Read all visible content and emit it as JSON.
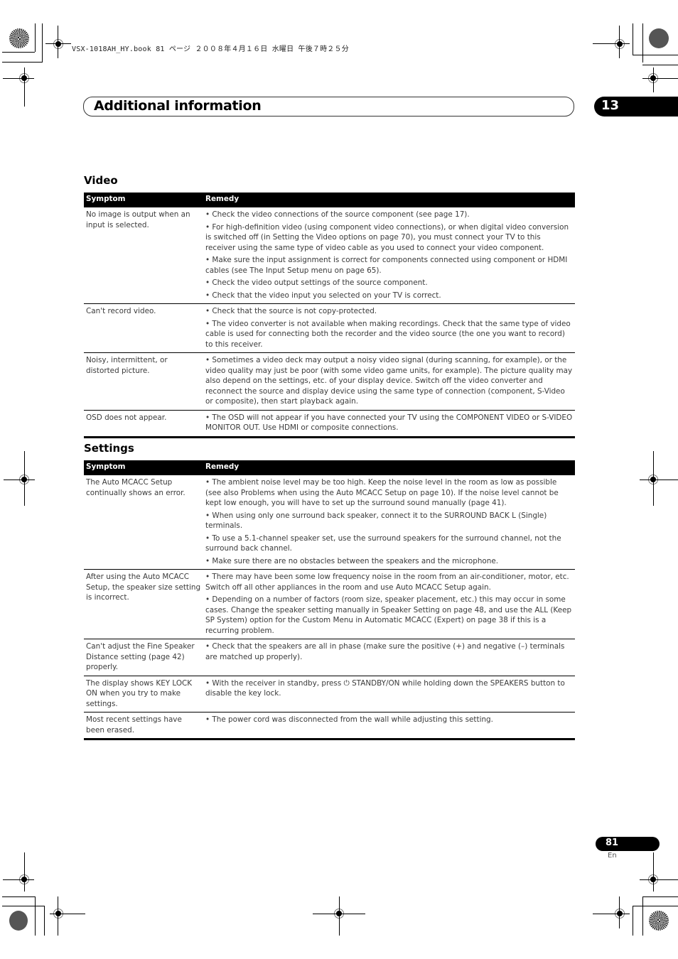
{
  "print_header": {
    "text": "VSX-1018AH_HY.book  81 ページ  ２００８年４月１６日  水曜日  午後７時２５分"
  },
  "chapter": {
    "title": "Additional information",
    "number": "13"
  },
  "sections": {
    "video": {
      "title": "Video",
      "columns": [
        "Symptom",
        "Remedy"
      ],
      "rows": [
        {
          "symptom": "No image is output when an input is selected.",
          "remedies": [
            "• Check the video connections of the source component (see page 17).",
            "• For high-definition video (using component video connections), or when digital video conversion is switched off (in Setting the Video options on page 70), you must connect your TV to this receiver using the same type of video cable as you used to connect your video component.",
            "• Make sure the input assignment is correct for components connected using component or HDMI cables (see The Input Setup menu on page 65).",
            "• Check the video output settings of the source component.",
            "• Check that the video input you selected on your TV is correct."
          ]
        },
        {
          "symptom": "Can't record video.",
          "remedies": [
            "• Check that the source is not copy-protected.",
            "• The video converter is not available when making recordings. Check that the same type of video cable is used for connecting both the recorder and the video source (the one you want to record) to this receiver."
          ]
        },
        {
          "symptom": "Noisy, intermittent, or distorted picture.",
          "remedies": [
            "• Sometimes a video deck may output a noisy video signal (during scanning, for example), or the video quality may just be poor (with some video game units, for example). The picture quality may also depend on the settings, etc. of your display device. Switch off the video converter and reconnect the source and display device using the same type of connection (component, S-Video or composite), then start playback again."
          ]
        },
        {
          "symptom": "OSD does not appear.",
          "remedies": [
            "• The OSD will not appear if you have connected your TV using the COMPONENT VIDEO or S-VIDEO MONITOR OUT. Use HDMI or composite connections."
          ]
        }
      ]
    },
    "settings": {
      "title": "Settings",
      "columns": [
        "Symptom",
        "Remedy"
      ],
      "rows": [
        {
          "symptom": "The Auto MCACC Setup continually shows an error.",
          "remedies": [
            "• The ambient noise level may be too high. Keep the noise level in the room as low as possible (see also Problems when using the Auto MCACC Setup on page 10). If the noise level cannot be kept low enough, you will have to set up the surround sound manually (page 41).",
            "• When using only one surround back speaker, connect it to the SURROUND BACK L (Single) terminals.",
            "• To use a 5.1-channel speaker set, use the surround speakers for the surround channel, not the surround back channel.",
            "• Make sure there are no obstacles between the speakers and the microphone."
          ]
        },
        {
          "symptom": "After using the Auto MCACC Setup, the speaker size setting is incorrect.",
          "remedies": [
            "• There may have been some low frequency noise in the room from an air-conditioner, motor, etc. Switch off all other appliances in the room and use Auto MCACC Setup again.",
            "• Depending on a number of factors (room size, speaker placement, etc.) this may occur in some cases. Change the speaker setting manually in Speaker Setting on page 48, and use the ALL (Keep SP System) option for the Custom Menu in Automatic MCACC (Expert) on page 38 if this is a recurring problem."
          ]
        },
        {
          "symptom": "Can't adjust the Fine Speaker Distance setting (page 42) properly.",
          "remedies": [
            "• Check that the speakers are all in phase (make sure the positive (+) and negative (–) terminals are matched up properly)."
          ]
        },
        {
          "symptom": "The display shows KEY LOCK ON when you try to make settings.",
          "remedies": [
            "• With the receiver in standby, press ⏻ STANDBY/ON while holding down the SPEAKERS button to disable the key lock."
          ]
        },
        {
          "symptom": "Most recent settings have been erased.",
          "remedies": [
            "• The power cord was disconnected from the wall while adjusting this setting."
          ]
        }
      ]
    }
  },
  "footer": {
    "page_number": "81",
    "language": "En"
  }
}
